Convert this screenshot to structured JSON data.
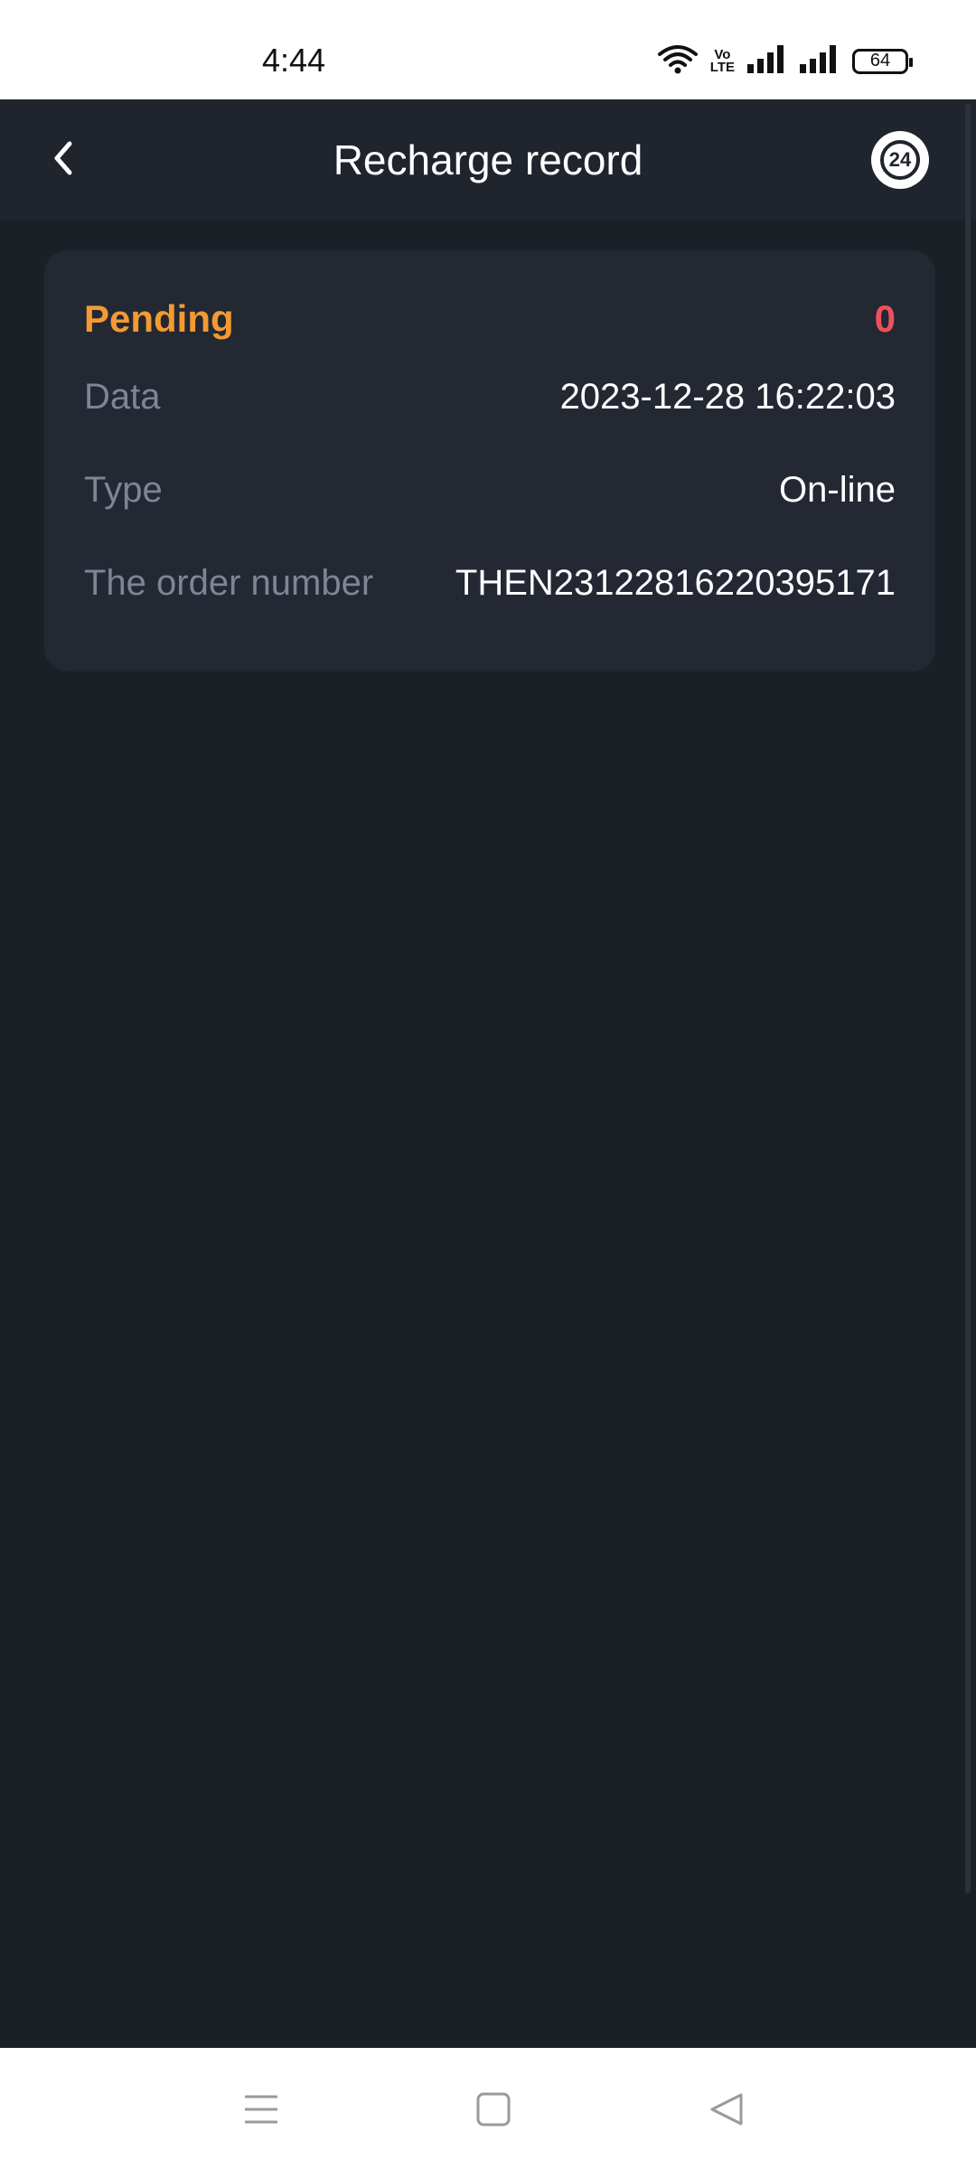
{
  "status_bar": {
    "time": "4:44",
    "volte_top": "Vo",
    "volte_bottom": "LTE",
    "battery": "64",
    "icons": [
      "wifi-icon",
      "volte-icon",
      "signal-icon",
      "signal-icon",
      "battery-icon"
    ]
  },
  "header": {
    "title": "Recharge record",
    "back_icon": "chevron-left-icon",
    "support_icon": "support-24-icon",
    "support_text": "24"
  },
  "record": {
    "status": "Pending",
    "amount": "0",
    "fields": [
      {
        "label": "Data",
        "value": "2023-12-28 16:22:03"
      },
      {
        "label": "Type",
        "value": "On-line"
      },
      {
        "label": "The order number",
        "value": "THEN23122816220395171"
      }
    ]
  },
  "nav_bar": {
    "icons": [
      "menu-icon",
      "home-icon",
      "back-icon"
    ]
  },
  "colors": {
    "background": "#1b1f26",
    "header": "#1f242d",
    "card": "#232833",
    "status_pending": "#f39a32",
    "amount": "#f0505a",
    "label": "#7d8596",
    "value": "#ffffff"
  }
}
